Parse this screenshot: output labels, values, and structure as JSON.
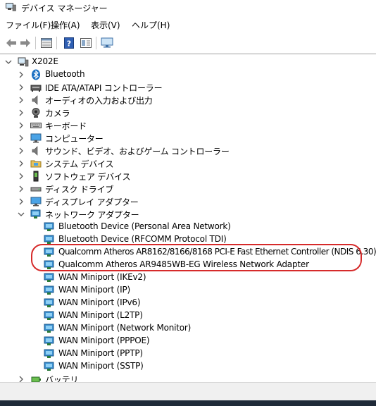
{
  "window": {
    "title": "デバイス マネージャー",
    "icon": "device-manager-icon"
  },
  "menubar": {
    "items": [
      {
        "label": "ファイル(F)"
      },
      {
        "label": "操作(A)"
      },
      {
        "label": "表示(V)"
      },
      {
        "label": "ヘルプ(H)"
      }
    ]
  },
  "toolbar": {
    "buttons": [
      {
        "icon": "back-arrow-icon"
      },
      {
        "icon": "forward-arrow-icon"
      },
      {
        "icon": "properties-grid-icon"
      },
      {
        "icon": "help-icon"
      },
      {
        "icon": "driver-properties-icon"
      },
      {
        "icon": "monitor-scan-icon"
      }
    ]
  },
  "tree": {
    "root": {
      "label": "X202E",
      "expanded": true,
      "icon": "computer-icon"
    },
    "categories": [
      {
        "label": "Bluetooth",
        "icon": "bluetooth-icon",
        "expanded": false
      },
      {
        "label": "IDE ATA/ATAPI コントローラー",
        "icon": "ide-controller-icon",
        "expanded": false
      },
      {
        "label": "オーディオの入力および出力",
        "icon": "speaker-icon",
        "expanded": false
      },
      {
        "label": "カメラ",
        "icon": "camera-icon",
        "expanded": false
      },
      {
        "label": "キーボード",
        "icon": "keyboard-icon",
        "expanded": false
      },
      {
        "label": "コンピューター",
        "icon": "monitor-icon",
        "expanded": false
      },
      {
        "label": "サウンド、ビデオ、およびゲーム コントローラー",
        "icon": "speaker-icon",
        "expanded": false
      },
      {
        "label": "システム デバイス",
        "icon": "system-folder-icon",
        "expanded": false
      },
      {
        "label": "ソフトウェア デバイス",
        "icon": "software-device-icon",
        "expanded": false
      },
      {
        "label": "ディスク ドライブ",
        "icon": "disk-drive-icon",
        "expanded": false
      },
      {
        "label": "ディスプレイ アダプター",
        "icon": "monitor-icon",
        "expanded": false
      },
      {
        "label": "ネットワーク アダプター",
        "icon": "network-adapter-icon",
        "expanded": true
      }
    ],
    "network_adapters": [
      {
        "label": "Bluetooth Device (Personal Area Network)"
      },
      {
        "label": "Bluetooth Device (RFCOMM Protocol TDI)"
      },
      {
        "label": "Qualcomm Atheros AR8162/8166/8168 PCI-E Fast Ethernet Controller (NDIS 6.30)"
      },
      {
        "label": "Qualcomm Atheros AR9485WB-EG Wireless Network Adapter"
      },
      {
        "label": "WAN Miniport (IKEv2)"
      },
      {
        "label": "WAN Miniport (IP)"
      },
      {
        "label": "WAN Miniport (IPv6)"
      },
      {
        "label": "WAN Miniport (L2TP)"
      },
      {
        "label": "WAN Miniport (Network Monitor)"
      },
      {
        "label": "WAN Miniport (PPPOE)"
      },
      {
        "label": "WAN Miniport (PPTP)"
      },
      {
        "label": "WAN Miniport (SSTP)"
      }
    ],
    "after": [
      {
        "label": "バッテリ",
        "icon": "battery-icon",
        "expanded": false
      }
    ]
  },
  "colors": {
    "highlight_ring": "#d62a2a",
    "network_icon": "#3a8fd0",
    "chevron": "#5a5a5a"
  }
}
